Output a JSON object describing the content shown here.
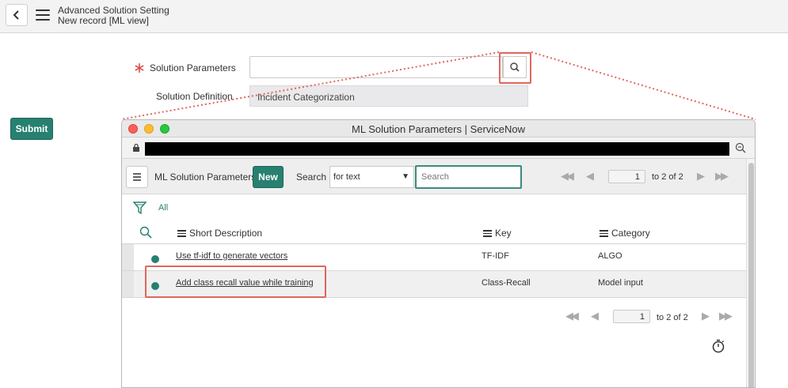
{
  "header": {
    "title_line1": "Advanced Solution Setting",
    "title_line2": "New record [ML view]",
    "back_icon": "chevron-left-icon",
    "menu_icon": "hamburger-icon"
  },
  "form": {
    "required_marker": "∗",
    "solution_parameters_label": "Solution Parameters",
    "solution_parameters_value": "",
    "solution_definition_label": "Solution Definition",
    "solution_definition_value": "Incident Categorization",
    "submit_label": "Submit"
  },
  "popup": {
    "window_title": "ML Solution Parameters | ServiceNow",
    "list_title": "ML Solution Parameters",
    "new_label": "New",
    "search_label": "Search",
    "search_field": "for text",
    "search_placeholder": "Search",
    "pagination": {
      "current_page": "1",
      "range_text": "to 2 of 2"
    },
    "filter_label": "All",
    "columns": [
      "Short Description",
      "Key",
      "Category"
    ],
    "rows": [
      {
        "short_description": "Use tf-idf to generate vectors",
        "key": "TF-IDF",
        "category": "ALGO"
      },
      {
        "short_description": "Add class recall value while training",
        "key": "Class-Recall",
        "category": "Model input"
      }
    ]
  },
  "colors": {
    "accent": "#278070",
    "highlight": "#e0665c",
    "required": "#e04c4c"
  }
}
